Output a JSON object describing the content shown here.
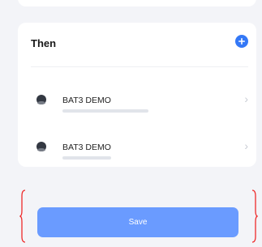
{
  "then_section": {
    "title": "Then",
    "actions": [
      {
        "device": "BAT3 DEMO"
      },
      {
        "device": "BAT3 DEMO"
      }
    ]
  },
  "footer": {
    "save_label": "Save"
  },
  "colors": {
    "accent": "#3478f6",
    "button": "#6a9bff",
    "bracket": "#ee2a2a",
    "background": "#f3f4f8"
  }
}
